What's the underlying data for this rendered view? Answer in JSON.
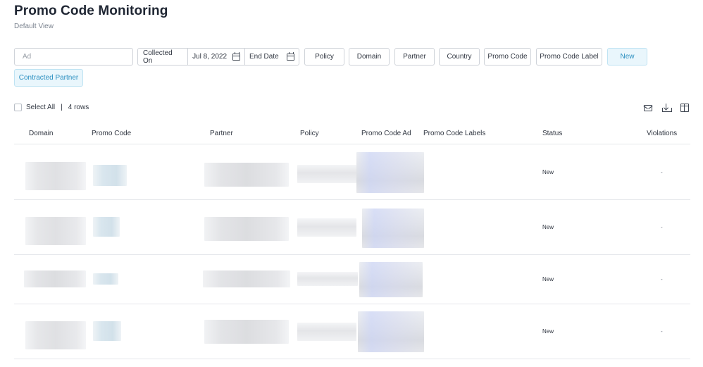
{
  "page": {
    "title": "Promo Code Monitoring",
    "subtitle": "Default View"
  },
  "filters": {
    "search_placeholder": "Ad",
    "collected_on_label": "Collected On",
    "start_date": "Jul 8, 2022",
    "end_date_label": "End Date",
    "chips": [
      "Policy",
      "Domain",
      "Partner",
      "Country",
      "Promo Code",
      "Promo Code Label",
      "New",
      "Contracted Partner"
    ]
  },
  "rows_bar": {
    "select_all_label": "Select All",
    "separator": "|",
    "row_count": "4 rows"
  },
  "toolbar_icons": [
    "mail-icon",
    "download-icon",
    "columns-icon"
  ],
  "table": {
    "headers": [
      "Domain",
      "Promo Code",
      "Partner",
      "Policy",
      "Promo Code Ad",
      "Promo Code Labels",
      "Status",
      "Violations"
    ],
    "rows": [
      {
        "status": "New",
        "violations": "-"
      },
      {
        "status": "New",
        "violations": "-"
      },
      {
        "status": "New",
        "violations": "-"
      },
      {
        "status": "New",
        "violations": "-"
      }
    ]
  },
  "colors": {
    "active_chip_bg": "#e9f6fc",
    "active_chip_text": "#2a8fc0",
    "border": "#cfd3d9"
  }
}
